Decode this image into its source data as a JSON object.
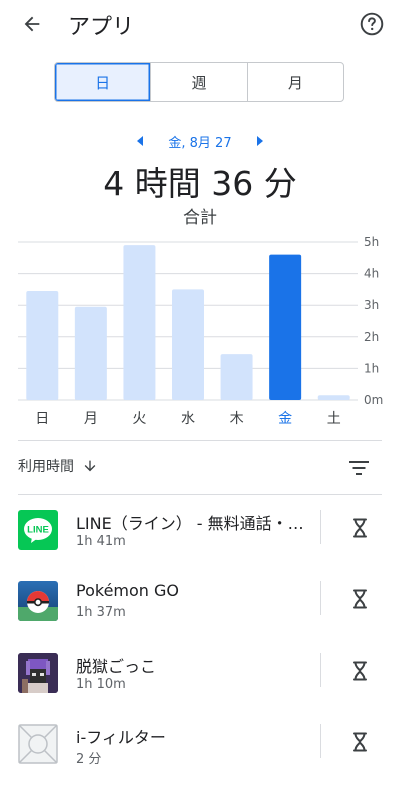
{
  "header": {
    "title": "アプリ"
  },
  "range_tabs": [
    {
      "label": "日",
      "selected": true
    },
    {
      "label": "週",
      "selected": false
    },
    {
      "label": "月",
      "selected": false
    }
  ],
  "date_nav": {
    "label": "金, 8月 27"
  },
  "summary": {
    "total": "4 時間 36 分",
    "label": "合計"
  },
  "chart_data": {
    "type": "bar",
    "categories": [
      "日",
      "月",
      "火",
      "水",
      "木",
      "金",
      "土"
    ],
    "values": [
      3.45,
      2.95,
      4.9,
      3.5,
      1.45,
      4.6,
      0.15
    ],
    "selected_index": 5,
    "y_ticks": [
      "0m",
      "1h",
      "2h",
      "3h",
      "4h",
      "5h"
    ],
    "ylim": [
      0,
      5
    ],
    "grid": true,
    "colors": {
      "bar": "#d2e3fc",
      "selected_bar": "#1a73e8",
      "selected_label": "#1a73e8"
    }
  },
  "sort": {
    "label": "利用時間"
  },
  "apps": [
    {
      "name": "LINE（ライン） - 無料通話・メール",
      "time": "1h 41m",
      "icon": "line-app-icon",
      "icon_text": "LINE"
    },
    {
      "name": "Pokémon GO",
      "time": "1h 37m",
      "icon": "pokemon-go-app-icon"
    },
    {
      "name": "脱獄ごっこ",
      "time": "1h 10m",
      "icon": "datsugoku-gokko-app-icon"
    },
    {
      "name": "i-フィルター",
      "time": "2 分",
      "icon": "i-filter-app-icon"
    }
  ],
  "colors": {
    "accent": "#1a73e8",
    "selected_bg": "#e8f0fe",
    "line_green": "#06c755"
  }
}
